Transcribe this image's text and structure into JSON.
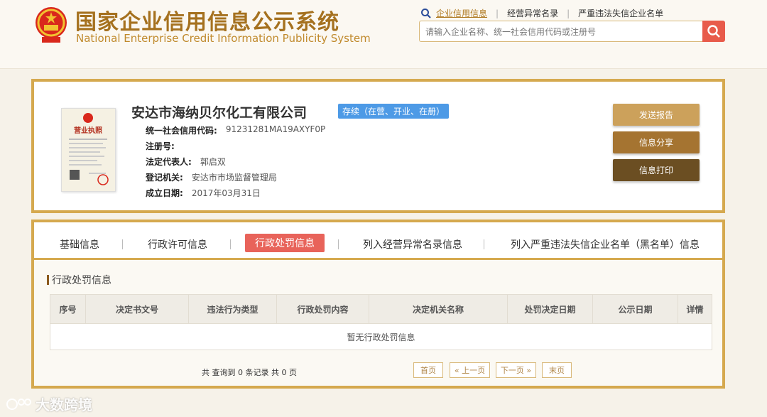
{
  "header": {
    "title_cn": "国家企业信用信息公示系统",
    "title_en": "National Enterprise Credit Information Publicity System",
    "nav": [
      "企业信用信息",
      "经营异常名录",
      "严重违法失信企业名单"
    ],
    "search_placeholder": "请输入企业名称、统一社会信用代码或注册号",
    "accent_color": "#a5711f",
    "search_button_color": "#e85b4b",
    "icons": [
      "national-emblem-icon",
      "search-icon",
      "magnifier-icon"
    ]
  },
  "company": {
    "name": "安达市海纳贝尔化工有限公司",
    "status": "存续（在营、开业、在册）",
    "license_image_label": "营业执照",
    "fields": [
      {
        "label": "统一社会信用代码:",
        "value": "91231281MA19AXYF0P"
      },
      {
        "label": "注册号:",
        "value": ""
      },
      {
        "label": "法定代表人:",
        "value": "郭启双"
      },
      {
        "label": "登记机关:",
        "value": "安达市市场监督管理局"
      },
      {
        "label": "成立日期:",
        "value": "2017年03月31日"
      }
    ],
    "actions": [
      "发送报告",
      "信息分享",
      "信息打印"
    ]
  },
  "tabs": {
    "items": [
      "基础信息",
      "行政许可信息",
      "行政处罚信息",
      "列入经营异常名录信息",
      "列入严重违法失信企业名单（黑名单）信息"
    ],
    "active": "行政处罚信息"
  },
  "penalty": {
    "section_title": "行政处罚信息",
    "columns": [
      "序号",
      "决定书文号",
      "违法行为类型",
      "行政处罚内容",
      "决定机关名称",
      "处罚决定日期",
      "公示日期",
      "详情"
    ],
    "empty_text": "暂无行政处罚信息",
    "record_count": "共 查询到 0 条记录 共 0 页",
    "pagination": [
      "首页",
      "« 上一页",
      "下一页 »",
      "末页"
    ]
  },
  "watermark": "大数跨境"
}
